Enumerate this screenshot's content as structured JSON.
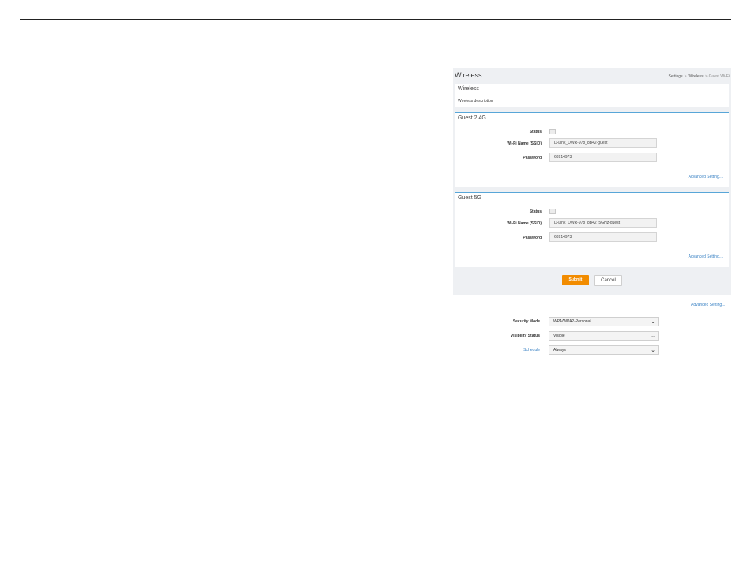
{
  "header": {
    "title": "Wireless",
    "breadcrumbs": [
      "Settings",
      "Wireless",
      "Guest Wi-Fi"
    ]
  },
  "intro": {
    "title": "Wireless",
    "description": "Wireless description"
  },
  "guest24": {
    "title": "Guest 2.4G",
    "status_label": "Status",
    "ssid_label": "Wi-Fi Name (SSID)",
    "ssid_value": "D-Link_DWR-978_8B42-guest",
    "password_label": "Password",
    "password_value": "63914973",
    "advanced_link": "Advanced Setting..."
  },
  "guest5": {
    "title": "Guest 5G",
    "status_label": "Status",
    "ssid_label": "Wi-Fi Name (SSID)",
    "ssid_value": "D-Link_DWR-978_8B42_5GHz-guest",
    "password_label": "Password",
    "password_value": "63914973",
    "advanced_link": "Advanced Setting..."
  },
  "actions": {
    "submit_label": "Submit",
    "cancel_label": "Cancel"
  },
  "advanced": {
    "link": "Advanced Setting...",
    "security_mode_label": "Security Mode",
    "security_mode_value": "WPA/WPA2-Personal",
    "visibility_label": "Visibility Status",
    "visibility_value": "Visible",
    "schedule_label": "Schedule",
    "schedule_value": "Always"
  },
  "colors": {
    "accent_orange": "#f28c00",
    "link_blue": "#3a82c4",
    "section_line": "#58a6d8",
    "panel_bg": "#eef0f3"
  }
}
